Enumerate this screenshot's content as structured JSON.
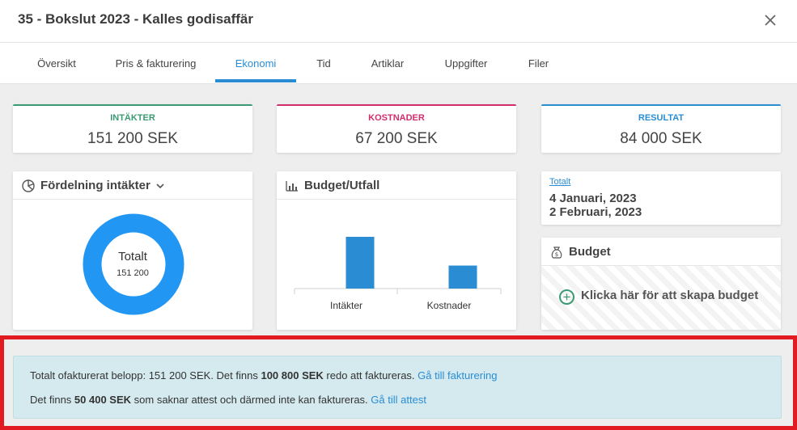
{
  "dialog": {
    "title": "35 - Bokslut 2023 - Kalles godisaffär"
  },
  "tabs": [
    {
      "label": "Översikt"
    },
    {
      "label": "Pris & fakturering"
    },
    {
      "label": "Ekonomi",
      "active": true
    },
    {
      "label": "Tid"
    },
    {
      "label": "Artiklar"
    },
    {
      "label": "Uppgifter"
    },
    {
      "label": "Filer"
    }
  ],
  "kpis": {
    "income": {
      "label": "INTÄKTER",
      "value": "151 200 SEK",
      "color": "#3a9a73"
    },
    "costs": {
      "label": "KOSTNADER",
      "value": "67 200 SEK",
      "color": "#d12d6d"
    },
    "result": {
      "label": "RESULTAT",
      "value": "84 000 SEK",
      "color": "#2a8dd4"
    }
  },
  "distribution": {
    "title": "Fördelning intäkter",
    "icon": "pie-chart-icon",
    "center_label": "Totalt",
    "center_value": "151 200",
    "ring_color": "#2196f3"
  },
  "budget_chart": {
    "title": "Budget/Utfall",
    "icon": "bar-chart-icon"
  },
  "chart_data": {
    "type": "bar",
    "categories": [
      "Intäkter",
      "Kostnader"
    ],
    "values": [
      151200,
      67200
    ],
    "color": "#2a8dd4"
  },
  "period": {
    "link": "Totalt",
    "start": "4 Januari, 2023",
    "end": "2 Februari, 2023"
  },
  "budget": {
    "title": "Budget",
    "icon": "money-bag-icon",
    "create_label": "Klicka här för att skapa budget"
  },
  "info": {
    "line1_pre": "Totalt ofakturerat belopp: 151 200 SEK. Det finns ",
    "line1_bold": "100 800 SEK",
    "line1_post": " redo att faktureras. ",
    "line1_link": "Gå till fakturering",
    "line2_pre": "Det finns ",
    "line2_bold": "50 400 SEK",
    "line2_post": " som saknar attest och därmed inte kan faktureras. ",
    "line2_link": "Gå till attest"
  }
}
